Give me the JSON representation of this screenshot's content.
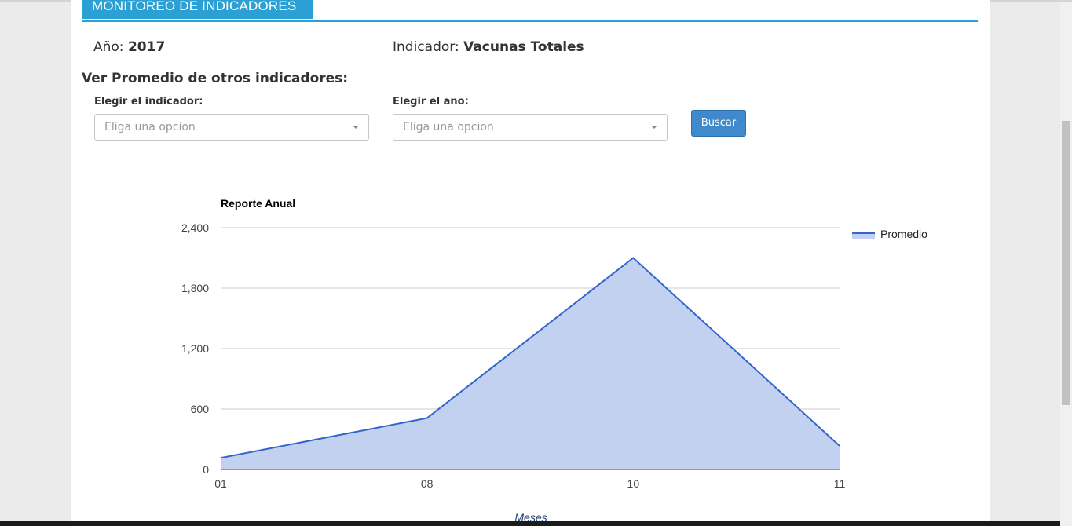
{
  "header": {
    "title": "MONITOREO DE INDICADORES"
  },
  "info": {
    "year_label": "Año:",
    "year_value": "2017",
    "indicator_label": "Indicador:",
    "indicator_value": "Vacunas Totales"
  },
  "filters": {
    "heading": "Ver Promedio de otros indicadores:",
    "indicator_label": "Elegir el indicador:",
    "indicator_placeholder": "Eliga una opcion",
    "year_label": "Elegir el año:",
    "year_placeholder": "Eliga una opcion",
    "search_button": "Buscar"
  },
  "chart_data": {
    "type": "area",
    "title": "Reporte Anual",
    "xlabel": "Meses",
    "ylabel": "",
    "categories": [
      "01",
      "08",
      "10",
      "11"
    ],
    "series": [
      {
        "name": "Promedio",
        "values": [
          115,
          510,
          2100,
          235
        ]
      }
    ],
    "ylim": [
      0,
      2400
    ],
    "yticks": [
      0,
      600,
      1200,
      1800,
      2400
    ],
    "ytick_labels": [
      "0",
      "600",
      "1,200",
      "1,800",
      "2,400"
    ],
    "grid": true,
    "legend": "right",
    "colors": {
      "line": "#3366cc",
      "fill": "#c2d1f0"
    }
  }
}
